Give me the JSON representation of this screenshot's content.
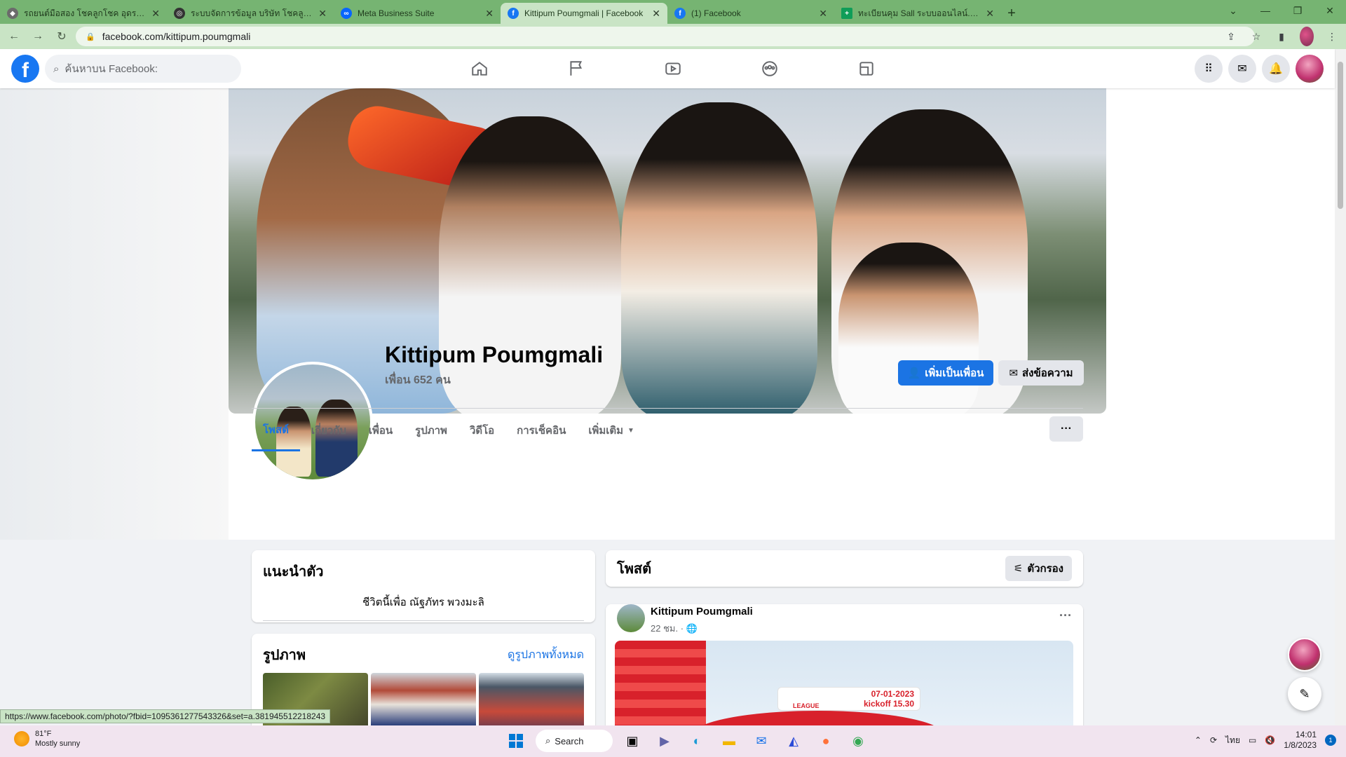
{
  "browser": {
    "tabs": [
      {
        "title": "รถยนต์มือสอง โชคลูกโชค อุดรธานี",
        "color": "#1f3a1d",
        "active": false
      },
      {
        "title": "ระบบจัดการข้อมูล บริษัท โชคลูกโชค",
        "color": "#1f3a1d",
        "active": false
      },
      {
        "title": "Meta Business Suite",
        "color": "#0866ff",
        "active": false
      },
      {
        "title": "Kittipum Poumgmali | Facebook",
        "color": "#1877f2",
        "active": true
      },
      {
        "title": "(1) Facebook",
        "color": "#1877f2",
        "active": false
      },
      {
        "title": "ทะเบียนคุม Sall ระบบออนไลน์.xlsx - G",
        "color": "#0f9d58",
        "active": false
      }
    ],
    "url": "facebook.com/kittipum.poumgmali",
    "status_url": "https://www.facebook.com/photo/?fbid=1095361277543326&set=a.381945512218243"
  },
  "facebook": {
    "search_placeholder": "ค้นหาบน Facebook:",
    "profile": {
      "name": "Kittipum Poumgmali",
      "friends": "เพื่อน 652 คน",
      "add_friend": "เพิ่มเป็นเพื่อน",
      "message": "ส่งข้อความ"
    },
    "tabs": [
      "โพสต์",
      "เกี่ยวกับ",
      "เพื่อน",
      "รูปภาพ",
      "วิดีโอ",
      "การเช็คอิน",
      "เพิ่มเติม"
    ],
    "more_dots": "···",
    "intro": {
      "title": "แนะนำตัว",
      "bio": "ชีวิตนี้เพื่อ ณัฐภัทร พวงมะลิ"
    },
    "photos": {
      "title": "รูปภาพ",
      "see_all": "ดูรูปภาพทั้งหมด"
    },
    "posts": {
      "title": "โพสต์",
      "filter": "ตัวกรอง"
    },
    "post": {
      "author": "Kittipum Poumgmali",
      "time": "22 ชม. ·",
      "banner_date": "07-01-2023",
      "banner_kickoff": "kickoff 15.30",
      "banner_league": "LEAGUE"
    }
  },
  "taskbar": {
    "temp": "81°F",
    "weather": "Mostly sunny",
    "search": "Search",
    "lang": "ไทย",
    "time": "14:01",
    "date": "1/8/2023",
    "notif_count": "1"
  }
}
